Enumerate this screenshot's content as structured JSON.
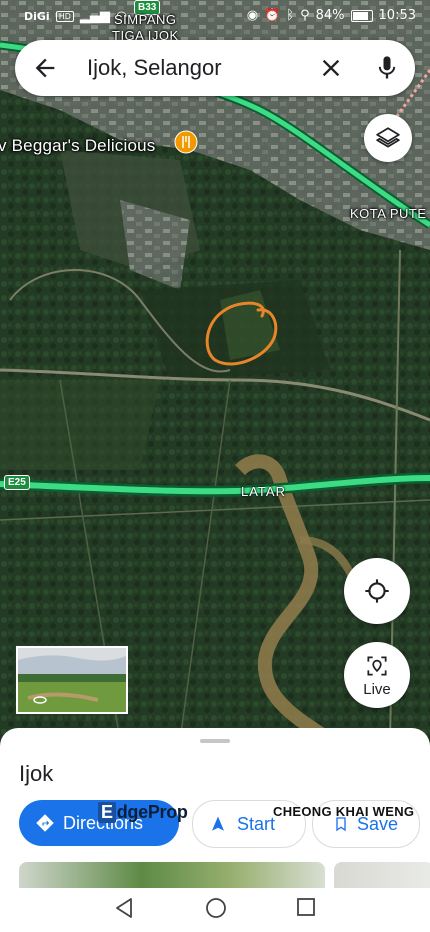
{
  "status_bar": {
    "carrier": "DiGi",
    "battery": "84%",
    "time": "10:53"
  },
  "search": {
    "query": "Ijok, Selangor"
  },
  "map": {
    "labels": {
      "town_line1": "SIMPANG",
      "town_line2": "TIGA IJOK",
      "poi": "v Beggar's Delicious",
      "kota": "KOTA PUTE",
      "road_e25_shield": "E25",
      "road_b33_shield": "B33",
      "road_name": "LATAR"
    },
    "colors": {
      "highway": "#3ddc84",
      "annotation": "#e8852a"
    },
    "live_label": "Live"
  },
  "sheet": {
    "title": "Ijok",
    "directions_label": "Directions",
    "start_label": "Start",
    "save_label": "Save"
  },
  "watermark": {
    "brand_e": "E",
    "brand_rest": "dgeProp",
    "agent": "CHEONG KHAI WENG"
  }
}
